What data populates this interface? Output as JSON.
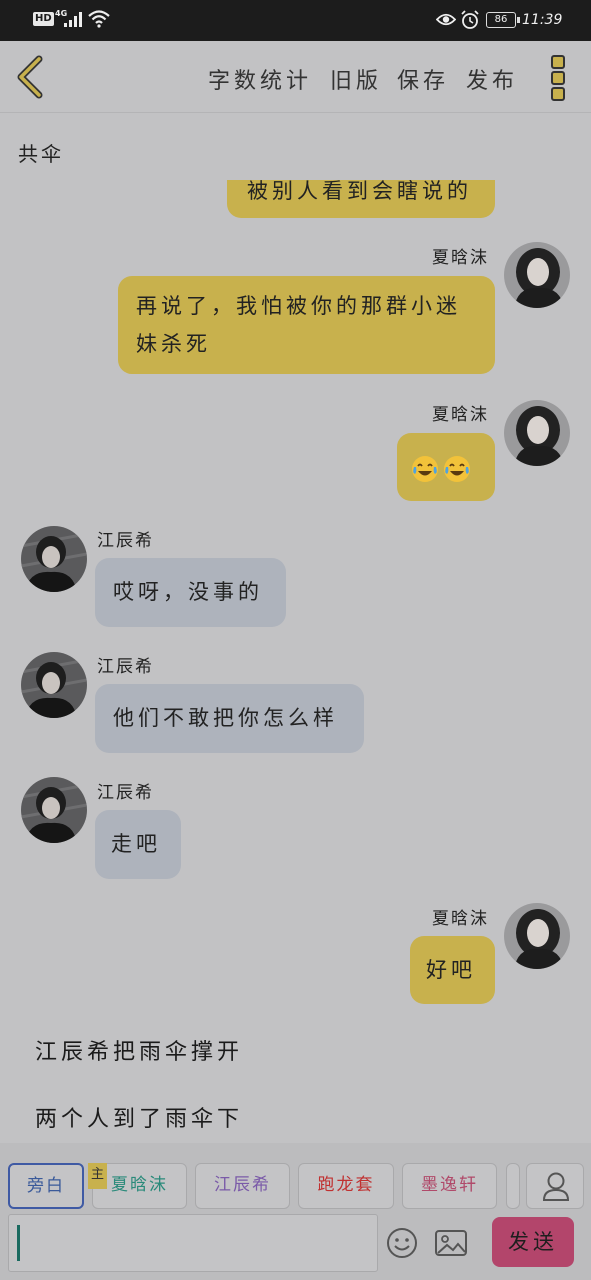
{
  "status_bar": {
    "hd": "HD",
    "network": "4G",
    "battery": "86",
    "time": "11:39"
  },
  "header": {
    "back_icon": "chevron-left-icon",
    "links": [
      "字数统计",
      "旧版",
      "保存",
      "发布"
    ],
    "menu_icon": "more-vertical-icon"
  },
  "doc_title": "共伞",
  "messages": [
    {
      "speaker": "",
      "side": "right",
      "text": "被别人看到会瞎说的",
      "partial": true
    },
    {
      "speaker": "夏晗沫",
      "side": "right",
      "lines": [
        "再说了，我怕被你的那群小迷",
        "妹杀死"
      ]
    },
    {
      "speaker": "夏晗沫",
      "side": "right",
      "emoji": [
        "face-with-tears-of-joy",
        "face-with-tears-of-joy"
      ]
    },
    {
      "speaker": "江辰希",
      "side": "left",
      "text": "哎呀，没事的"
    },
    {
      "speaker": "江辰希",
      "side": "left",
      "text": "他们不敢把你怎么样"
    },
    {
      "speaker": "江辰希",
      "side": "left",
      "text": "走吧"
    },
    {
      "speaker": "夏晗沫",
      "side": "right",
      "text": "好吧"
    }
  ],
  "narration": [
    "江辰希把雨伞撑开",
    "两个人到了雨伞下"
  ],
  "characters": [
    {
      "label": "旁白",
      "color": "#3a5a9a",
      "active": true
    },
    {
      "label": "夏晗沫",
      "color": "#2a8a7a",
      "main_tag": "主"
    },
    {
      "label": "江辰希",
      "color": "#7a5aa8"
    },
    {
      "label": "跑龙套",
      "color": "#c03030"
    },
    {
      "label": "墨逸轩",
      "color": "#b04a6a"
    }
  ],
  "input": {
    "value": ""
  },
  "send_label": "发送",
  "colors": {
    "me_bubble": "#c8b14d",
    "other_bubble": "#aeb3bc",
    "send": "#b3456b"
  }
}
